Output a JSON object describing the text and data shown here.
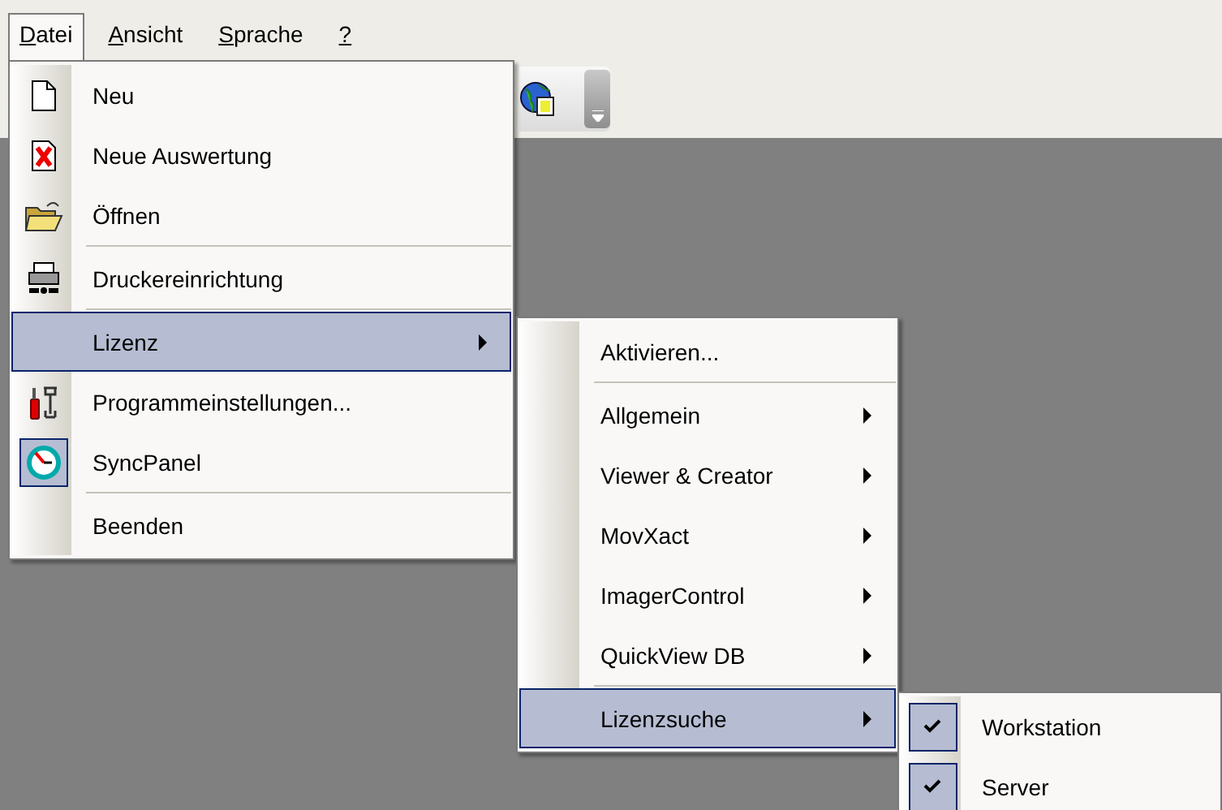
{
  "menu_bar": [
    {
      "label": "Datei",
      "selected": true
    },
    {
      "label": "Ansicht",
      "selected": false
    },
    {
      "label": "Sprache",
      "selected": false
    },
    {
      "label": "?",
      "selected": false
    }
  ],
  "file_menu": {
    "items": [
      {
        "kind": "item",
        "label": "Neu",
        "checked": false,
        "selected": false,
        "submenu": false
      },
      {
        "kind": "item",
        "label": "Neue Auswertung",
        "checked": false,
        "selected": false,
        "submenu": false
      },
      {
        "kind": "item",
        "label": "Öffnen",
        "checked": false,
        "selected": false,
        "submenu": false
      },
      {
        "kind": "separator"
      },
      {
        "kind": "item",
        "label": "Druckereinrichtung",
        "checked": false,
        "selected": false,
        "submenu": false
      },
      {
        "kind": "separator"
      },
      {
        "kind": "item",
        "label": "Lizenz",
        "checked": false,
        "selected": true,
        "submenu": true
      },
      {
        "kind": "item",
        "label": "Programmeinstellungen...",
        "checked": false,
        "selected": false,
        "submenu": false
      },
      {
        "kind": "item",
        "label": "SyncPanel",
        "checked": true,
        "selected": false,
        "submenu": false
      },
      {
        "kind": "separator"
      },
      {
        "kind": "item",
        "label": "Beenden",
        "checked": false,
        "selected": false,
        "submenu": false
      }
    ]
  },
  "license_menu": {
    "items": [
      {
        "kind": "item",
        "label": "Aktivieren...",
        "checked": false,
        "selected": false,
        "submenu": false
      },
      {
        "kind": "separator"
      },
      {
        "kind": "item",
        "label": "Allgemein",
        "checked": false,
        "selected": false,
        "submenu": true
      },
      {
        "kind": "item",
        "label": "Viewer & Creator",
        "checked": false,
        "selected": false,
        "submenu": true
      },
      {
        "kind": "item",
        "label": "MovXact",
        "checked": false,
        "selected": false,
        "submenu": true
      },
      {
        "kind": "item",
        "label": "ImagerControl",
        "checked": false,
        "selected": false,
        "submenu": true
      },
      {
        "kind": "item",
        "label": "QuickView DB",
        "checked": false,
        "selected": false,
        "submenu": true
      },
      {
        "kind": "separator"
      },
      {
        "kind": "item",
        "label": "Lizenzsuche",
        "checked": false,
        "selected": true,
        "submenu": true
      }
    ]
  },
  "license_search_menu": {
    "items": [
      {
        "kind": "item",
        "label": "Workstation",
        "checked": true,
        "selected": false,
        "submenu": false
      },
      {
        "kind": "item",
        "label": "Server",
        "checked": true,
        "selected": false,
        "submenu": false
      }
    ]
  }
}
